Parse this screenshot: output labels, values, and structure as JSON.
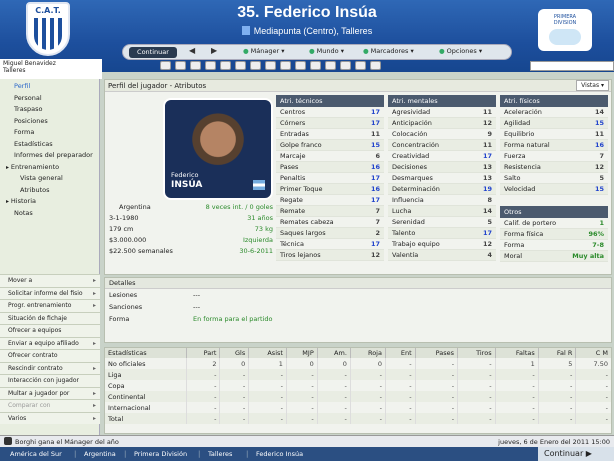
{
  "header": {
    "crest_text": "C.A.T.",
    "title": "35. Federico Insúa",
    "subtitle": "Mediapunta (Centro), Talleres",
    "badge_line1": "PRIMERA",
    "badge_line2": "DIVISION"
  },
  "topbar": {
    "continue": "Continuar",
    "menus": [
      "Mánager",
      "Mundo",
      "Marcadores",
      "Opciones"
    ]
  },
  "user": {
    "name": "Miguel Benavidez",
    "club": "Talleres"
  },
  "sidebar": {
    "items": [
      "Perfil",
      "Personal",
      "Traspaso",
      "Posiciones",
      "Forma",
      "Estadísticas",
      "Informes del preparador",
      "Entrenamiento",
      "Vista general",
      "Atributos",
      "Historia",
      "Notas"
    ],
    "actions": [
      "Mover a",
      "Solicitar informe del fisio",
      "Progr. entrenamiento",
      "Situación de fichaje",
      "Ofrecer a equipos",
      "Enviar a equipo afiliado",
      "Ofrecer contrato",
      "Rescindir contrato",
      "Interacción con jugador",
      "Multar a jugador por",
      "Comparar con",
      "Varios"
    ]
  },
  "panel": {
    "title": "Perfil del jugador - Atributos",
    "views": "Vistas",
    "photo_first": "Federico",
    "photo_last": "INSÚA"
  },
  "player": {
    "nationality": "Argentina",
    "caps": "8 veces int. / 0 goles",
    "dob": "3-1-1980",
    "age": "31 años",
    "height": "179 cm",
    "weight": "73 kg",
    "value": "$3.000.000",
    "foot": "Izquierda",
    "wage": "$22.500 semanales",
    "contract": "30-6-2011"
  },
  "attributes": {
    "technical_title": "Atri. técnicos",
    "mental_title": "Atri. mentales",
    "physical_title": "Atri. físicos",
    "technical": [
      [
        "Centros",
        17
      ],
      [
        "Córners",
        17
      ],
      [
        "Entradas",
        11
      ],
      [
        "Golpe franco",
        15
      ],
      [
        "Marcaje",
        6
      ],
      [
        "Pases",
        16
      ],
      [
        "Penaltis",
        17
      ],
      [
        "Primer Toque",
        16
      ],
      [
        "Regate",
        17
      ],
      [
        "Remate",
        7
      ],
      [
        "Remates cabeza",
        7
      ],
      [
        "Saques largos",
        2
      ],
      [
        "Técnica",
        17
      ],
      [
        "Tiros lejanos",
        12
      ]
    ],
    "mental": [
      [
        "Agresividad",
        11
      ],
      [
        "Anticipación",
        12
      ],
      [
        "Colocación",
        9
      ],
      [
        "Concentración",
        11
      ],
      [
        "Creatividad",
        17
      ],
      [
        "Decisiones",
        13
      ],
      [
        "Desmarques",
        13
      ],
      [
        "Determinación",
        19
      ],
      [
        "Influencia",
        8
      ],
      [
        "Lucha",
        14
      ],
      [
        "Serenidad",
        5
      ],
      [
        "Talento",
        17
      ],
      [
        "Trabajo equipo",
        12
      ],
      [
        "Valentía",
        4
      ]
    ],
    "physical": [
      [
        "Aceleración",
        14
      ],
      [
        "Agilidad",
        15
      ],
      [
        "Equilibrio",
        11
      ],
      [
        "Forma natural",
        16
      ],
      [
        "Fuerza",
        7
      ],
      [
        "Resistencia",
        12
      ],
      [
        "Salto",
        5
      ],
      [
        "Velocidad",
        15
      ]
    ]
  },
  "others": {
    "title": "Otros",
    "rows": [
      [
        "Calif. de portero",
        "1"
      ],
      [
        "Forma física",
        "96%"
      ],
      [
        "Forma",
        "7-8"
      ],
      [
        "Moral",
        "Muy alta"
      ]
    ]
  },
  "details": {
    "title": "Detalles",
    "rows": [
      [
        "Lesiones",
        "---"
      ],
      [
        "Sanciones",
        "---"
      ],
      [
        "Forma",
        "En forma para el partido"
      ]
    ]
  },
  "stats": {
    "headers": [
      "Estadísticas",
      "Part",
      "Gls",
      "Asist",
      "MJP",
      "Am.",
      "Roja",
      "Ent",
      "Pases",
      "Tiros",
      "Faltas",
      "Fal R",
      "C M"
    ],
    "rows": [
      [
        "No oficiales",
        "2",
        "0",
        "1",
        "0",
        "0",
        "0",
        "-",
        "-",
        "-",
        "1",
        "5",
        "7.50"
      ],
      [
        "Liga",
        "-",
        "-",
        "-",
        "-",
        "-",
        "-",
        "-",
        "-",
        "-",
        "-",
        "-",
        "-"
      ],
      [
        "Copa",
        "-",
        "-",
        "-",
        "-",
        "-",
        "-",
        "-",
        "-",
        "-",
        "-",
        "-",
        "-"
      ],
      [
        "Continental",
        "-",
        "-",
        "-",
        "-",
        "-",
        "-",
        "-",
        "-",
        "-",
        "-",
        "-",
        "-"
      ],
      [
        "Internacional",
        "-",
        "-",
        "-",
        "-",
        "-",
        "-",
        "-",
        "-",
        "-",
        "-",
        "-",
        "-"
      ],
      [
        "Total",
        "-",
        "-",
        "-",
        "-",
        "-",
        "-",
        "-",
        "-",
        "-",
        "-",
        "-",
        "-"
      ]
    ]
  },
  "news": {
    "text": "Borghi gana el Mánager del año",
    "date": "jueves, 6 de Enero del 2011 15:00"
  },
  "breadcrumbs": [
    "América del Sur",
    "Argentina",
    "Primera División",
    "Talleres",
    "Federico Insúa"
  ],
  "continue_bottom": "Continuar"
}
